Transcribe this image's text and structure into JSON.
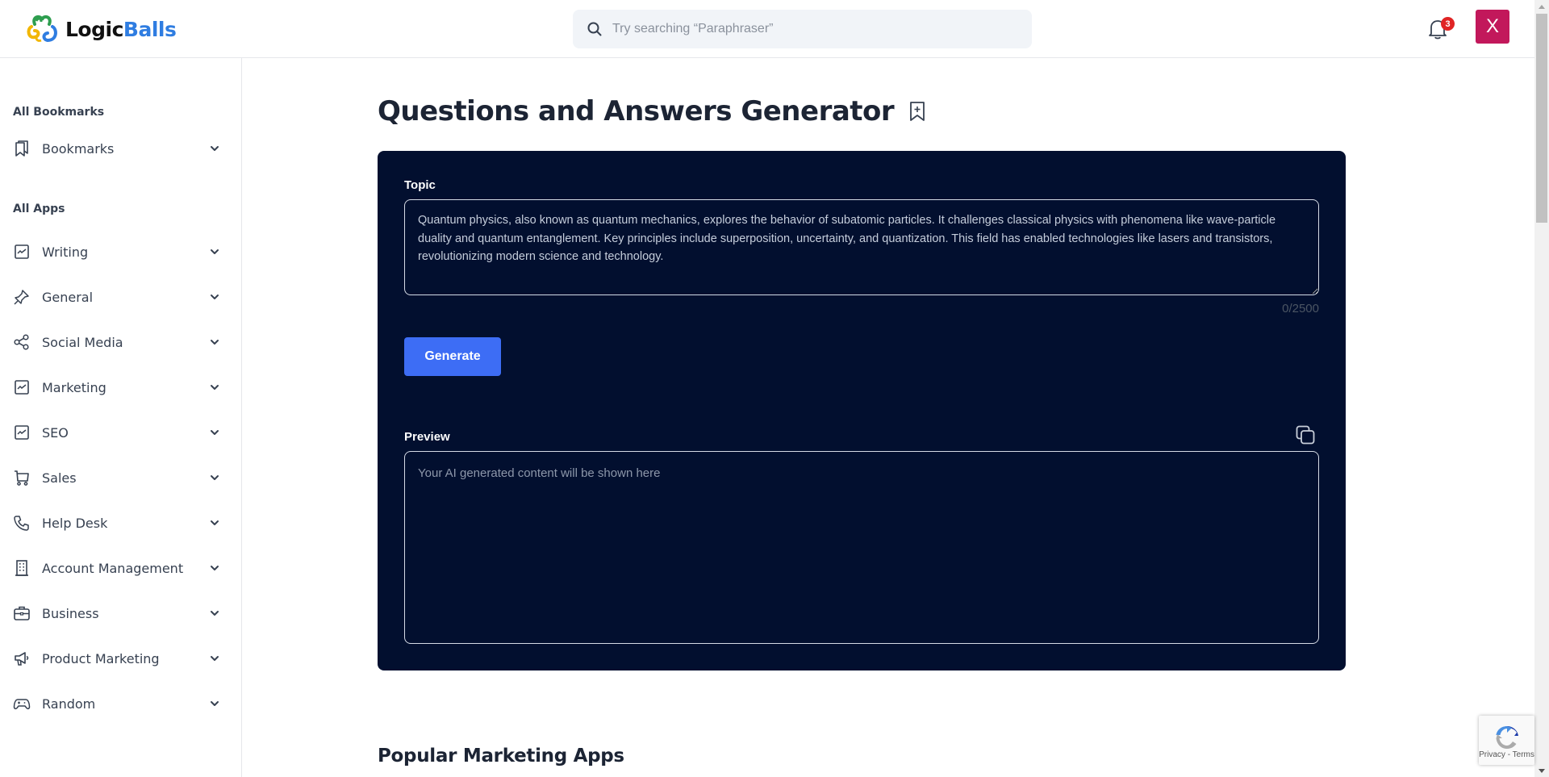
{
  "header": {
    "logo": {
      "part1": "Logic",
      "part2": "Balls"
    },
    "search": {
      "placeholder": "Try searching “Paraphraser”",
      "value": "",
      "icon": "search-icon"
    },
    "notifications": {
      "icon": "bell-icon",
      "count": "3"
    },
    "user": {
      "initial": "X",
      "color": "#c2185b"
    }
  },
  "sidebar": {
    "sections": [
      {
        "title": "All Bookmarks",
        "items": [
          {
            "label": "Bookmarks",
            "icon": "bookmarks-icon"
          }
        ]
      },
      {
        "title": "All Apps",
        "items": [
          {
            "label": "Writing",
            "icon": "chart-icon"
          },
          {
            "label": "General",
            "icon": "pin-icon"
          },
          {
            "label": "Social Media",
            "icon": "share-icon"
          },
          {
            "label": "Marketing",
            "icon": "chart-icon"
          },
          {
            "label": "SEO",
            "icon": "chart-icon"
          },
          {
            "label": "Sales",
            "icon": "cart-icon"
          },
          {
            "label": "Help Desk",
            "icon": "phone-icon"
          },
          {
            "label": "Account Management",
            "icon": "building-icon"
          },
          {
            "label": "Business",
            "icon": "briefcase-icon"
          },
          {
            "label": "Product Marketing",
            "icon": "megaphone-icon"
          },
          {
            "label": "Random",
            "icon": "gamepad-icon"
          }
        ]
      }
    ]
  },
  "main": {
    "title": "Questions and Answers Generator",
    "topic": {
      "label": "Topic",
      "value": "Quantum physics, also known as quantum mechanics, explores the behavior of subatomic particles. It challenges classical physics with phenomena like wave-particle duality and quantum entanglement. Key principles include superposition, uncertainty, and quantization. This field has enabled technologies like lasers and transistors, revolutionizing modern science and technology.",
      "counter": "0/2500"
    },
    "generate_label": "Generate",
    "preview": {
      "label": "Preview",
      "placeholder": "Your AI generated content will be shown here"
    },
    "popular_section_title": "Popular Marketing Apps"
  },
  "recaptcha": {
    "text": "Privacy - Terms"
  },
  "colors": {
    "accent": "#3d6df5",
    "card_bg": "#020f2f",
    "brand_blue": "#2f7de1",
    "badge_red": "#e02424"
  }
}
